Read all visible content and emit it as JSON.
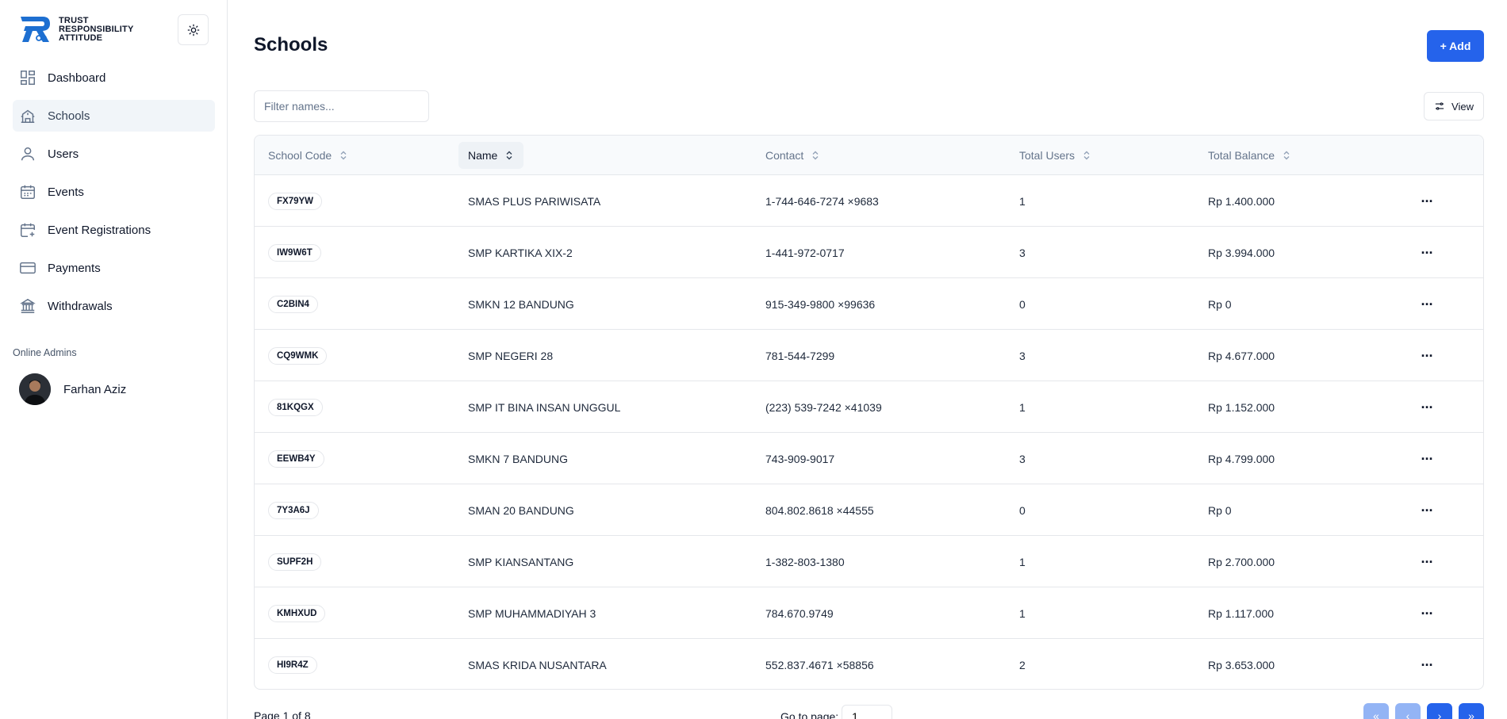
{
  "brand": {
    "line1": "TRUST",
    "line2": "RESPONSIBILITY",
    "line3": "ATTITUDE"
  },
  "colors": {
    "accent": "#2563eb",
    "accent_disabled": "#93b4f5",
    "active_nav": "#f1f5f9",
    "border": "#e5e7eb"
  },
  "sidebar": {
    "items": [
      {
        "label": "Dashboard",
        "icon": "dashboard-icon"
      },
      {
        "label": "Schools",
        "icon": "school-icon",
        "active": true
      },
      {
        "label": "Users",
        "icon": "user-icon"
      },
      {
        "label": "Events",
        "icon": "calendar-icon"
      },
      {
        "label": "Event Registrations",
        "icon": "calendar-plus-icon"
      },
      {
        "label": "Payments",
        "icon": "credit-card-icon"
      },
      {
        "label": "Withdrawals",
        "icon": "bank-icon"
      }
    ],
    "online_label": "Online Admins",
    "admins": [
      {
        "name": "Farhan Aziz"
      }
    ]
  },
  "header": {
    "title": "Schools",
    "add_label": "+ Add"
  },
  "filter": {
    "placeholder": "Filter names...",
    "value": ""
  },
  "view_label": "View",
  "table": {
    "columns": [
      "School Code",
      "Name",
      "Contact",
      "Total Users",
      "Total Balance"
    ],
    "rows": [
      {
        "code": "FX79YW",
        "name": "SMAS PLUS PARIWISATA",
        "contact": "1-744-646-7274 ×9683",
        "users": "1",
        "balance": "Rp 1.400.000"
      },
      {
        "code": "IW9W6T",
        "name": "SMP KARTIKA XIX-2",
        "contact": "1-441-972-0717",
        "users": "3",
        "balance": "Rp 3.994.000"
      },
      {
        "code": "C2BIN4",
        "name": "SMKN 12 BANDUNG",
        "contact": "915-349-9800 ×99636",
        "users": "0",
        "balance": "Rp 0"
      },
      {
        "code": "CQ9WMK",
        "name": "SMP NEGERI 28",
        "contact": "781-544-7299",
        "users": "3",
        "balance": "Rp 4.677.000"
      },
      {
        "code": "81KQGX",
        "name": "SMP IT BINA INSAN UNGGUL",
        "contact": "(223) 539-7242 ×41039",
        "users": "1",
        "balance": "Rp 1.152.000"
      },
      {
        "code": "EEWB4Y",
        "name": "SMKN 7 BANDUNG",
        "contact": "743-909-9017",
        "users": "3",
        "balance": "Rp 4.799.000"
      },
      {
        "code": "7Y3A6J",
        "name": "SMAN 20 BANDUNG",
        "contact": "804.802.8618 ×44555",
        "users": "0",
        "balance": "Rp 0"
      },
      {
        "code": "SUPF2H",
        "name": "SMP KIANSANTANG",
        "contact": "1-382-803-1380",
        "users": "1",
        "balance": "Rp 2.700.000"
      },
      {
        "code": "KMHXUD",
        "name": "SMP MUHAMMADIYAH 3",
        "contact": "784.670.9749",
        "users": "1",
        "balance": "Rp 1.117.000"
      },
      {
        "code": "HI9R4Z",
        "name": "SMAS KRIDA NUSANTARA",
        "contact": "552.837.4671 ×58856",
        "users": "2",
        "balance": "Rp 3.653.000"
      }
    ]
  },
  "pagination": {
    "page_info": "Page 1 of 8",
    "goto_label": "Go to page:",
    "goto_value": "1",
    "first": "«",
    "prev": "‹",
    "next": "›",
    "last": "»"
  }
}
